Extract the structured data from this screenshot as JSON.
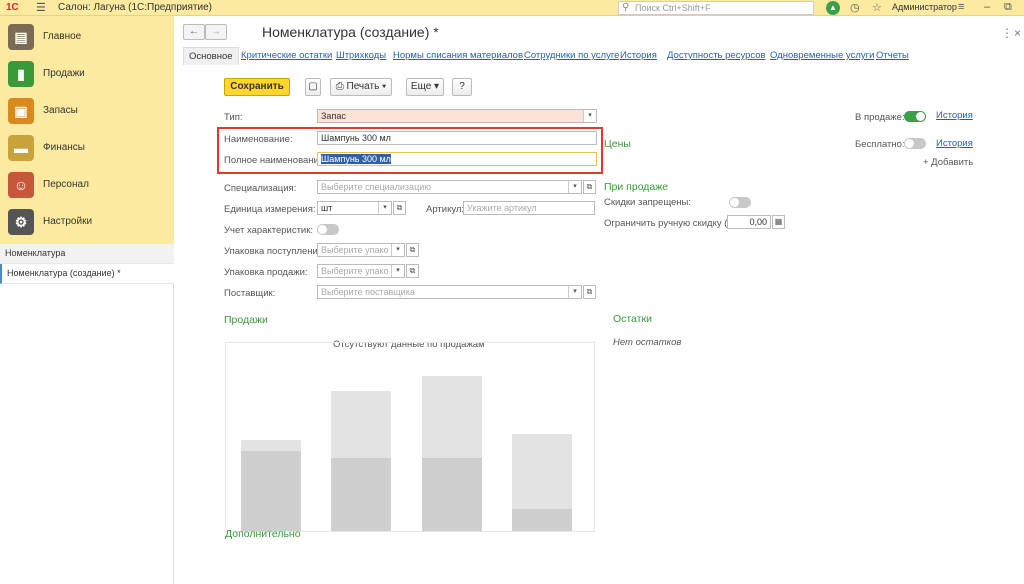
{
  "app": {
    "logo": "1С",
    "title": "Салон: Лагуна  (1С:Предприятие)",
    "search_placeholder": "Поиск Ctrl+Shift+F",
    "user": "Администратор"
  },
  "sidebar": {
    "items": [
      {
        "label": "Главное",
        "icon": "clipboard-icon",
        "color": "#7a6b52"
      },
      {
        "label": "Продажи",
        "icon": "chart-icon",
        "color": "#3a9a3a"
      },
      {
        "label": "Запасы",
        "icon": "box-icon",
        "color": "#d88a1c"
      },
      {
        "label": "Финансы",
        "icon": "wallet-icon",
        "color": "#c9a23a"
      },
      {
        "label": "Персонал",
        "icon": "people-icon",
        "color": "#c7573a"
      },
      {
        "label": "Настройки",
        "icon": "gear-icon",
        "color": "#555555"
      }
    ],
    "open_windows": [
      {
        "label": "Номенклатура",
        "active": false
      },
      {
        "label": "Номенклатура (создание) *",
        "active": true
      }
    ]
  },
  "header": {
    "title": "Номенклатура (создание) *"
  },
  "tabs": [
    {
      "label": "Основное",
      "active": true
    },
    {
      "label": "Критические остатки"
    },
    {
      "label": "Штрихкоды"
    },
    {
      "label": "Нормы списания материалов"
    },
    {
      "label": "Сотрудники по услуге"
    },
    {
      "label": "История"
    },
    {
      "label": "Доступность ресурсов"
    },
    {
      "label": "Одновременные услуги"
    },
    {
      "label": "Отчеты"
    }
  ],
  "toolbar": {
    "save": "Сохранить",
    "print": "Печать",
    "more": "Еще",
    "help": "?"
  },
  "form": {
    "type_label": "Тип:",
    "type_value": "Запас",
    "name_label": "Наименование:",
    "name_value": "Шампунь 300 мл",
    "fullname_label": "Полное наименование:",
    "fullname_value": "Шампунь 300 мл",
    "spec_label": "Специализация:",
    "spec_placeholder": "Выберите специализацию",
    "unit_label": "Единица измерения:",
    "unit_value": "шт",
    "article_label": "Артикул:",
    "article_placeholder": "Укажите артикул",
    "char_label": "Учет характеристик:",
    "pack_in_label": "Упаковка поступления:",
    "pack_in_placeholder": "Выберите упако",
    "pack_out_label": "Упаковка продажи:",
    "pack_out_placeholder": "Выберите упако",
    "supplier_label": "Поставщик:",
    "supplier_placeholder": "Выберите поставщика"
  },
  "right": {
    "on_sale_label": "В продаже:",
    "history1": "История",
    "free_label": "Бесплатно:",
    "history2": "История",
    "add": "+ Добавить",
    "prices": "Цены",
    "on_sale_header": "При продаже",
    "discount_forbidden": "Скидки запрещены:",
    "limit_discount": "Ограничить ручную скидку (%):",
    "limit_value": "0,00"
  },
  "sales": {
    "header": "Продажи",
    "no_data": "Отсутствуют данные по продажам"
  },
  "stock": {
    "header": "Остатки",
    "no_stock": "Нет остатков"
  },
  "additional": "Дополнительно"
}
